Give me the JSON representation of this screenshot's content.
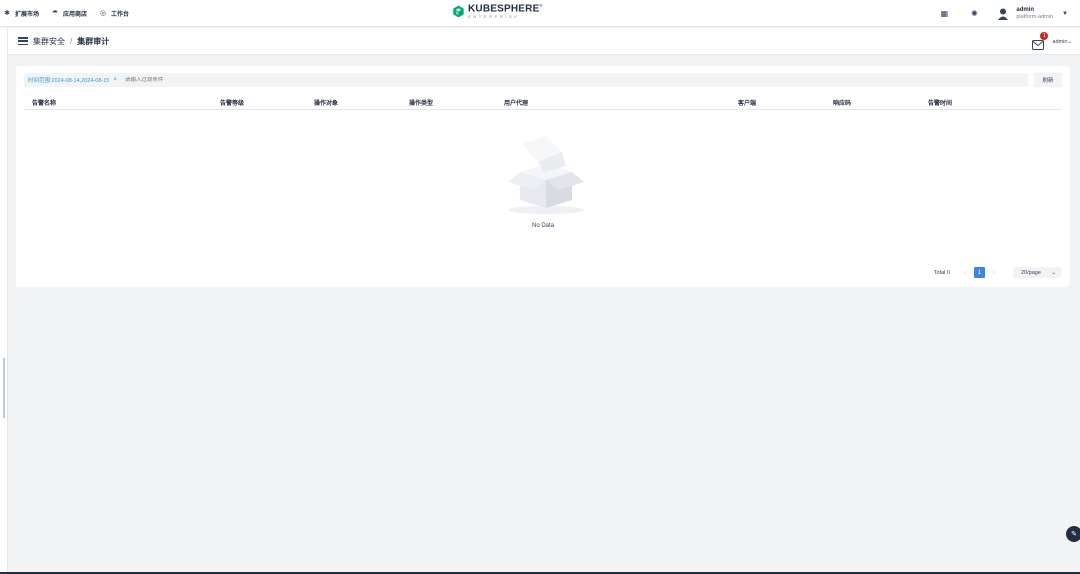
{
  "topnav": {
    "items": [
      {
        "label": "扩展市场",
        "icon": "puzzle-icon"
      },
      {
        "label": "应用商店",
        "icon": "store-icon"
      },
      {
        "label": "工作台",
        "icon": "workbench-icon"
      }
    ],
    "logo": {
      "name": "KUBESPHERE",
      "sub": "ENTERPRISE",
      "reg": "®"
    },
    "user": {
      "name": "admin",
      "role": "platform-admin"
    }
  },
  "breadcrumb": {
    "parent": "集群安全",
    "separator": "/",
    "current": "集群审计",
    "notification_count": "1",
    "admin_label": "admin"
  },
  "filter": {
    "tag_label": "时间范围:2024-08-14,2024-08-15",
    "tag_close": "×",
    "placeholder": "请输入过滤条件",
    "refresh_label": "刷新"
  },
  "table": {
    "columns": [
      "告警名称",
      "告警等级",
      "操作对象",
      "操作类型",
      "用户代理",
      "客户端",
      "响应码",
      "告警时间"
    ]
  },
  "empty": {
    "text": "No Data"
  },
  "pagination": {
    "total": "Total 0",
    "prev": "‹",
    "page": "1",
    "next": "›",
    "page_size": "20/page"
  },
  "colors": {
    "accent": "#3b86e0",
    "link": "#329dce",
    "badge": "#ca2621",
    "brand": "#00aa72"
  }
}
